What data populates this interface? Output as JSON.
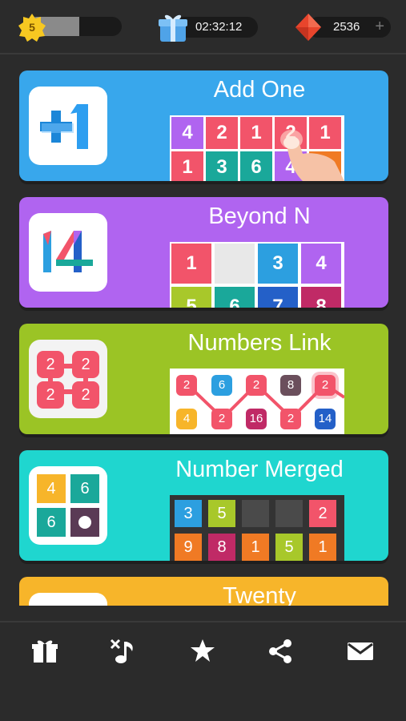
{
  "status": {
    "level": "5",
    "timer": "02:32:12",
    "gems": "2536",
    "gems_plus": "+"
  },
  "modes": [
    {
      "title": "Add One",
      "color": "#38a7ec",
      "icon_text": "+1",
      "preview_cells": [
        "4",
        "2",
        "1",
        "2",
        "1",
        "1",
        "3",
        "6",
        "4",
        "1"
      ]
    },
    {
      "title": "Beyond N",
      "color": "#b064f0",
      "icon_text": "14",
      "preview_cells": [
        "1",
        "",
        "3",
        "4",
        "5",
        "6",
        "7",
        "8"
      ]
    },
    {
      "title": "Numbers Link",
      "color": "#9bc425",
      "icon_text": "2",
      "preview_cells": [
        "2",
        "6",
        "2",
        "8",
        "2",
        "4",
        "2",
        "16",
        "2",
        "14"
      ]
    },
    {
      "title": "Number Merged",
      "color": "#1fd6cf",
      "icon_cells": [
        "4",
        "6",
        "6",
        ""
      ],
      "preview_cells": [
        "3",
        "5",
        "",
        "",
        "2",
        "9",
        "8",
        "1",
        "5",
        "1"
      ]
    },
    {
      "title": "Twenty",
      "color": "#f7b52a"
    }
  ],
  "colors": {
    "red": "#f2546a",
    "teal": "#1aa89a",
    "purple": "#b064f0",
    "orange": "#f07a24",
    "lime": "#a8c82a",
    "blue": "#2c9fe0",
    "darkblue": "#2460c8",
    "maroon": "#c02a66",
    "grey": "#4a4a4a"
  },
  "nav": [
    "gift-icon",
    "music-mute-icon",
    "star-icon",
    "share-icon",
    "mail-icon"
  ]
}
